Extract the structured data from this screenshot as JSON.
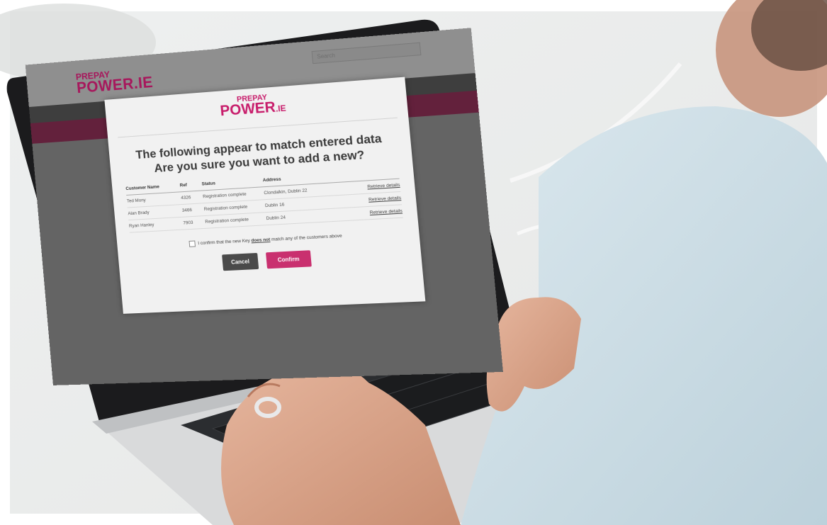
{
  "site": {
    "logo_small": "PREPAY",
    "logo_big": "POWER",
    "logo_suffix": ".IE",
    "search_placeholder": "Search"
  },
  "modal": {
    "logo_small": "PREPAY",
    "logo_big": "POWER",
    "logo_suffix": ".IE",
    "title_line1": "The following appear to match entered data",
    "title_line2": "Are you sure you want to add a new?",
    "columns": [
      "Customer Name",
      "Ref",
      "Status",
      "Address"
    ],
    "rows": [
      {
        "name": "Ted Mony",
        "ref": "4326",
        "status": "Registration complete",
        "address": "Clondalkin, Dublin 22",
        "link": "Retrieve details"
      },
      {
        "name": "Alan Brady",
        "ref": "3466",
        "status": "Registration complete",
        "address": "Dublin 16",
        "link": "Retrieve details"
      },
      {
        "name": "Ryan Hanley",
        "ref": "7903",
        "status": "Registration complete",
        "address": "Dublin 24",
        "link": "Retrieve details"
      }
    ],
    "confirm_pre": "I confirm that the new Key ",
    "confirm_emph": "does not",
    "confirm_post": " match any of the customers above",
    "cancel_label": "Cancel",
    "confirm_label": "Confirm"
  },
  "colors": {
    "brand": "#c81e6c",
    "plum": "#63213c",
    "skin": "#d7a086",
    "shirt": "#c7d9e2"
  }
}
